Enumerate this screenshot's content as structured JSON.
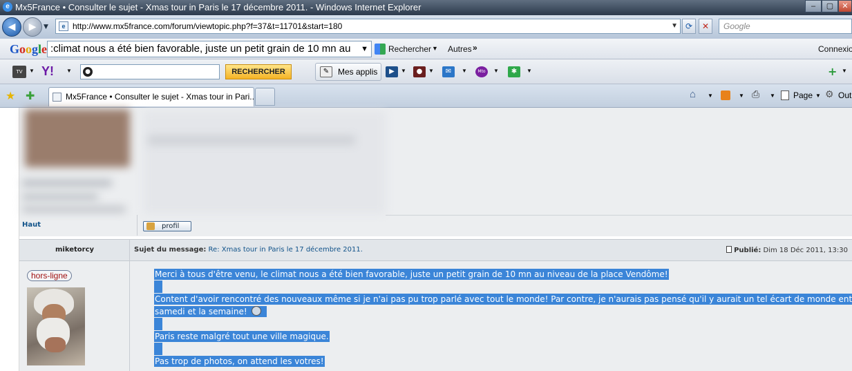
{
  "window": {
    "title": "Mx5France • Consulter le sujet - Xmas tour in Paris le 17 décembre 2011. - Windows Internet Explorer",
    "buttons": {
      "minimize": "–",
      "maximize": "▢",
      "close": "✕"
    }
  },
  "address_bar": {
    "url": "http://www.mx5france.com/forum/viewtopic.php?f=37&t=11701&start=180",
    "search_placeholder": "Google"
  },
  "google_toolbar": {
    "logo": "Google",
    "query": ":climat nous a été bien favorable, juste un petit grain de 10 mn au",
    "search_button": "Rechercher",
    "more": "Autres",
    "connexion": "Connexio"
  },
  "yahoo_toolbar": {
    "search_button": "RECHERCHER",
    "apps_button": "Mes applis"
  },
  "tabs": {
    "active_tab": "Mx5France • Consulter le sujet - Xmas tour in Pari...",
    "command_page": "Page",
    "command_tools": "Out"
  },
  "forum": {
    "haut_link": "Haut",
    "profil_button": "profil",
    "post": {
      "author": "miketorcy",
      "subject_label": "Sujet du message:",
      "subject": "Re: Xmas tour in Paris le 17 décembre 2011.",
      "published_label": "Publié:",
      "published_date": "Dim 18 Déc 2011, 13:30",
      "status_badge": "hors-ligne",
      "lines": {
        "l1": "Merci à tous d'être venu, le climat nous a été bien favorable, juste un petit grain de 10 mn au niveau de la place Vendôme!",
        "l2": "Content d'avoir rencontré des nouveaux même si je n'ai pas pu trop parlé avec tout le monde! Par contre, je n'aurais pas pensé qu'il y aurait un tel écart de monde entre le",
        "l3": "samedi et la semaine!",
        "l4": "Paris reste malgré tout une ville magique.",
        "l5": "Pas trop de photos, on attend les votres!"
      }
    }
  },
  "colors": {
    "selection": "#3b85d8",
    "link": "#105289",
    "post_bg": "#eceef0"
  }
}
